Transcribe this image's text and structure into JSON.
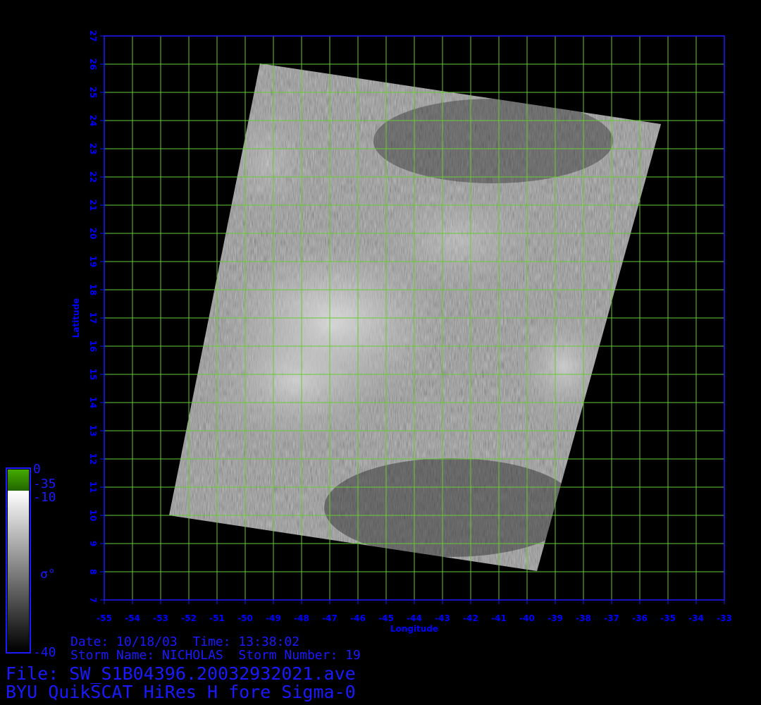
{
  "plot": {
    "x_axis_label": "Longitude",
    "y_axis_label": "Latitude",
    "lon_ticks": [
      "-55",
      "-54",
      "-53",
      "-52",
      "-51",
      "-50",
      "-49",
      "-48",
      "-47",
      "-46",
      "-45",
      "-44",
      "-43",
      "-42",
      "-41",
      "-40",
      "-39",
      "-38",
      "-37",
      "-36",
      "-35",
      "-34",
      "-33"
    ],
    "lat_ticks": [
      "7",
      "8",
      "9",
      "10",
      "11",
      "12",
      "13",
      "14",
      "15",
      "16",
      "17",
      "18",
      "19",
      "20",
      "21",
      "22",
      "23",
      "24",
      "25",
      "26",
      "27"
    ]
  },
  "colorbar": {
    "top_value": "0",
    "green_bottom_value": "-35",
    "white_top_value": "-10",
    "symbol": "σ°",
    "bottom_value": "-40"
  },
  "info": {
    "date_line": "Date: 10/18/03  Time: 13:38:02",
    "storm_line": "Storm Name: NICHOLAS  Storm Number: 19",
    "file_line": "File: SW_S1B04396.20032932021.ave",
    "product_line": "BYU QuikSCAT HiRes H fore Sigma-0"
  },
  "colors": {
    "frame": "#1a1aff",
    "grid": "#66cc33",
    "text": "#1a1aff",
    "colorbar_green": "#339900"
  }
}
